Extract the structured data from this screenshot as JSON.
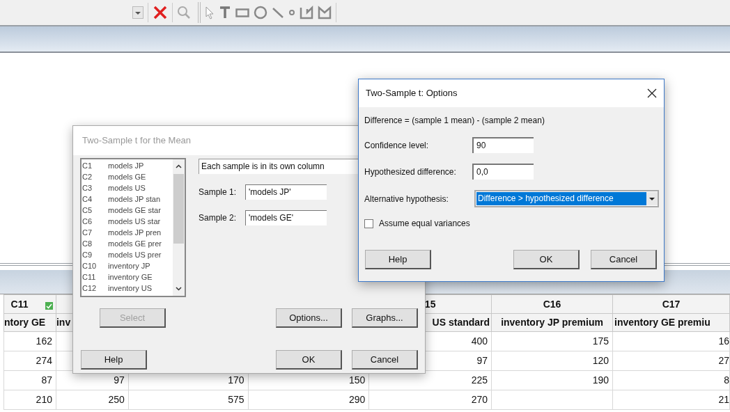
{
  "worksheet": {
    "columns": [
      {
        "id": "C11",
        "name": "ntory GE",
        "marked": true
      },
      {
        "name": "inv"
      },
      {},
      {},
      {
        "id": "15",
        "name": "US standard",
        "marked": false
      },
      {
        "id": "C16",
        "name": "inventory JP premium",
        "marked": false
      },
      {
        "id": "C17",
        "name": "inventory GE premiu",
        "marked": false
      }
    ],
    "rows": [
      [
        "162",
        null,
        null,
        null,
        "400",
        "175",
        "16"
      ],
      [
        "274",
        null,
        null,
        null,
        "97",
        "120",
        "27"
      ],
      [
        "87",
        "97",
        "170",
        "150",
        "225",
        "190",
        "8"
      ],
      [
        "210",
        "250",
        "575",
        "290",
        "270",
        null,
        "21"
      ]
    ]
  },
  "sample_dialog": {
    "title": "Two-Sample t for the Mean",
    "columns": [
      {
        "id": "C1",
        "name": "models JP"
      },
      {
        "id": "C2",
        "name": "models GE"
      },
      {
        "id": "C3",
        "name": "models US"
      },
      {
        "id": "C4",
        "name": "models JP stan"
      },
      {
        "id": "C5",
        "name": "models GE star"
      },
      {
        "id": "C6",
        "name": "models US star"
      },
      {
        "id": "C7",
        "name": "models JP pren"
      },
      {
        "id": "C8",
        "name": "models GE prer"
      },
      {
        "id": "C9",
        "name": "models US prer"
      },
      {
        "id": "C10",
        "name": "inventory JP"
      },
      {
        "id": "C11",
        "name": "inventory GE"
      },
      {
        "id": "C12",
        "name": "inventory US"
      }
    ],
    "mode": "Each sample is in its own column",
    "fields": [
      {
        "label": "Sample 1:",
        "value": "'models JP'"
      },
      {
        "label": "Sample 2:",
        "value": "'models GE'"
      }
    ],
    "buttons": [
      {
        "label": "Select",
        "disabled": true
      },
      {
        "label": "Options...",
        "disabled": false
      },
      {
        "label": "Graphs...",
        "disabled": false
      },
      {
        "label": "Help",
        "disabled": false
      },
      {
        "label": "OK",
        "disabled": false
      },
      {
        "label": "Cancel",
        "disabled": false
      }
    ]
  },
  "options_dialog": {
    "title": "Two-Sample t: Options",
    "formula": "Difference = (sample 1 mean) - (sample 2 mean)",
    "fields": [
      {
        "label": "Confidence level:",
        "value": "90"
      },
      {
        "label": "Hypothesized difference:",
        "value": "0,0"
      }
    ],
    "alternative": {
      "label": "Alternative hypothesis:",
      "value": "Difference > hypothesized difference"
    },
    "equal_variances": {
      "label": "Assume equal variances",
      "checked": false
    },
    "buttons": [
      "Help",
      "OK",
      "Cancel"
    ]
  }
}
